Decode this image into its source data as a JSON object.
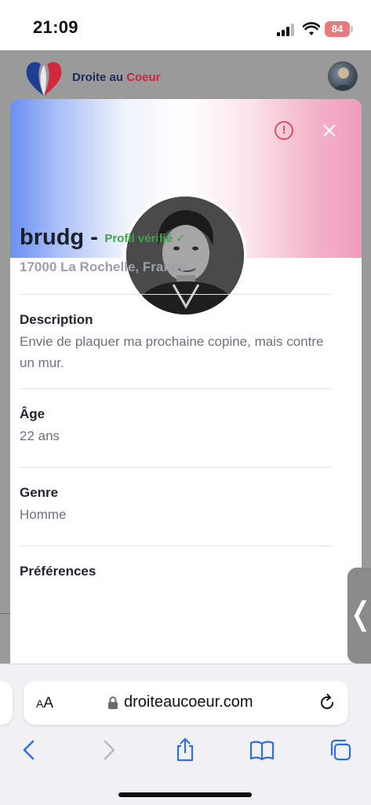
{
  "status_bar": {
    "time": "21:09",
    "battery_level": "84",
    "icons": [
      "signal-icon",
      "wifi-icon",
      "battery-icon"
    ]
  },
  "site": {
    "name_part1": "Droite au ",
    "name_part2": "Coeur",
    "brand_colors": {
      "navy": "#1f2d5a",
      "red": "#c6283a"
    }
  },
  "profile": {
    "username": "brudg -",
    "verified_label": "Profil vérifié ✓",
    "location": "17000 La Rochelle, France",
    "sections": [
      {
        "label": "Description",
        "value": "Envie de plaquer ma prochaine copine, mais contre un mur."
      },
      {
        "label": "Âge",
        "value": "22 ans"
      },
      {
        "label": "Genre",
        "value": "Homme"
      },
      {
        "label": "Préférences",
        "value": ""
      }
    ],
    "banner_colors": {
      "left": "#6a8ff0",
      "middle": "#ffffff",
      "right": "#ef9cbc"
    },
    "verified_color": "#3fa34d"
  },
  "side_handle": {
    "glyph": "❬"
  },
  "browser": {
    "aa_label_small": "A",
    "aa_label_large": "A",
    "url": "droiteaucoeur.com",
    "icons": [
      "lock-icon",
      "reload-icon",
      "back-icon",
      "forward-icon",
      "share-icon",
      "bookmarks-icon",
      "tabs-icon"
    ]
  }
}
